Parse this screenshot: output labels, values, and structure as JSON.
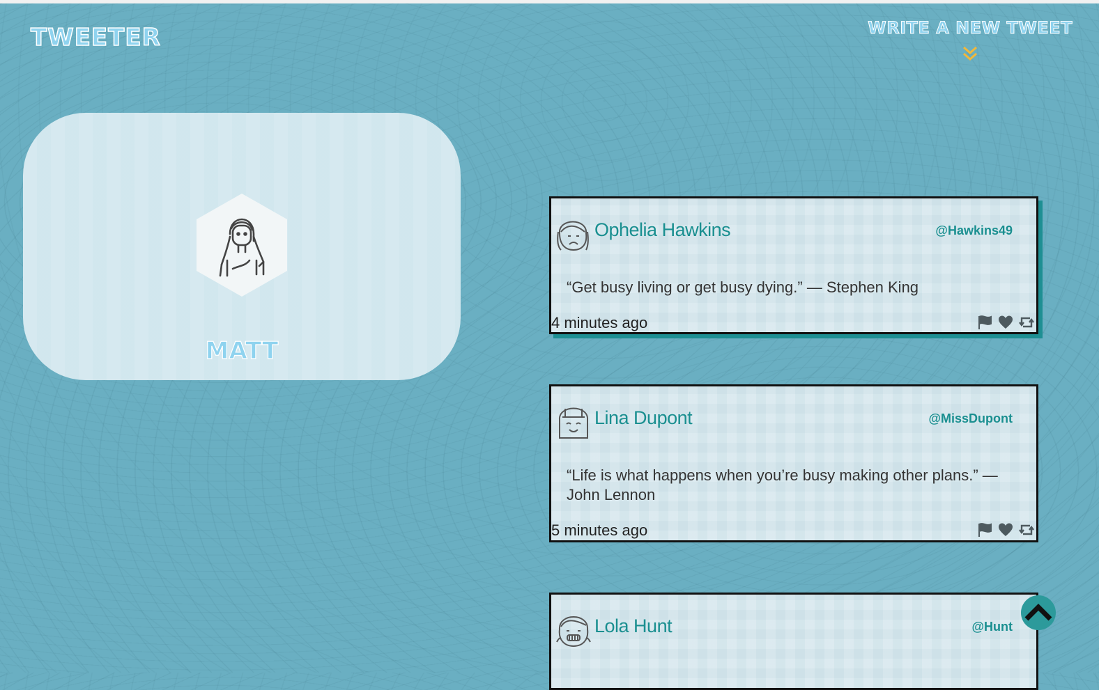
{
  "nav": {
    "brand": "Tweeter",
    "compose_label": "Write a new tweet",
    "compose_icon": "double-chevron-down-icon"
  },
  "profile": {
    "name": "Matt",
    "avatar_icon": "user-avatar-icon"
  },
  "tweets": [
    {
      "author": "Ophelia Hawkins",
      "handle": "@Hawkins49",
      "text": "“Get busy living or get busy dying.” — Stephen King",
      "time": "4 minutes ago",
      "avatar_icon": "sad-face-avatar-icon"
    },
    {
      "author": "Lina Dupont",
      "handle": "@MissDupont",
      "text": "“Life is what happens when you’re busy making other plans.” — John Lennon",
      "time": "5 minutes ago",
      "avatar_icon": "smiling-face-avatar-icon"
    },
    {
      "author": "Lola Hunt",
      "handle": "@Hunt",
      "avatar_icon": "grinning-face-avatar-icon"
    }
  ],
  "actions": [
    "flag-icon",
    "heart-icon",
    "retweet-icon"
  ],
  "scroll_top_icon": "chevron-up-icon",
  "colors": {
    "background": "#6aafc2",
    "accent": "#1a8f90",
    "brand_text": "#8fd3ef",
    "card": "#d4e6ec"
  }
}
